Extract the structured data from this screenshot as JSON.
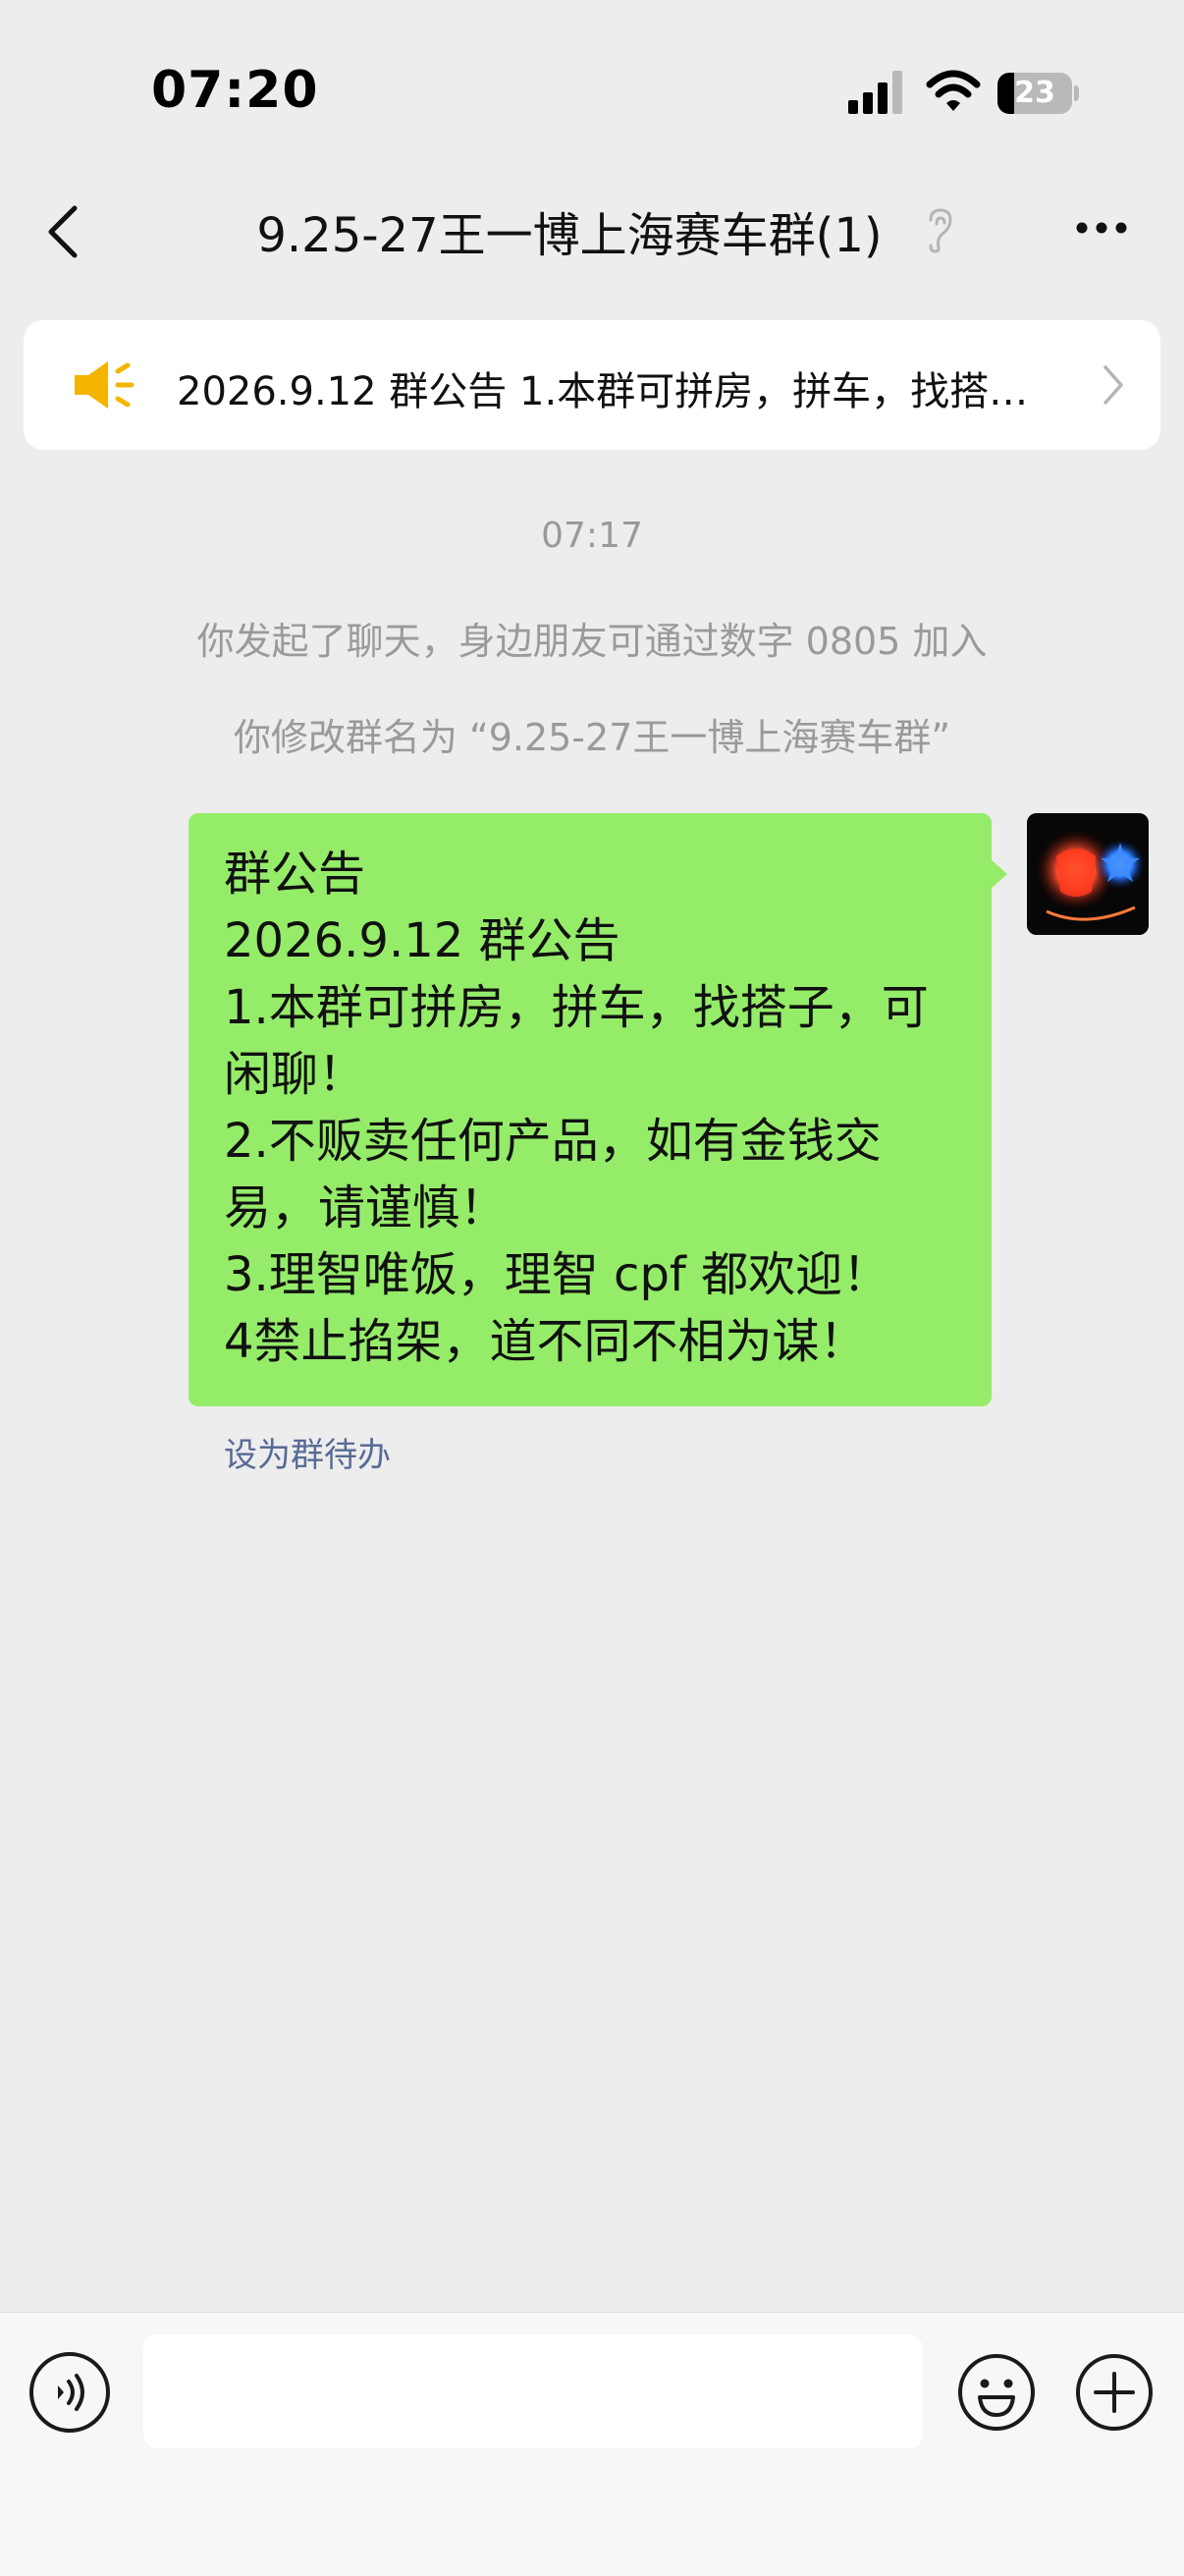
{
  "status_bar": {
    "time": "07:20",
    "battery_level": "23",
    "battery_fraction": 0.23,
    "icons": [
      "signal-icon",
      "wifi-icon",
      "battery-icon"
    ]
  },
  "nav": {
    "title": "9.25-27王一博上海赛车群(1)",
    "icons": [
      "back-icon",
      "mute-icon",
      "more-icon"
    ]
  },
  "announcement": {
    "text": "2026.9.12 群公告 1.本群可拼房，拼车，找搭…",
    "icons": [
      "speaker-icon",
      "chevron-right-icon"
    ]
  },
  "chat": {
    "time": "07:17",
    "system_messages": [
      "你发起了聊天，身边朋友可通过数字 0805 加入",
      "你修改群名为 “9.25-27王一博上海赛车群”"
    ],
    "message": {
      "lines": [
        "群公告",
        "2026.9.12 群公告",
        "1.本群可拼房，拼车，找搭子，可",
        "闲聊！",
        "2.不贩卖任何产品，如有金钱交",
        "易，请谨慎！",
        "3.理智唯饭，理智 cpf 都欢迎！",
        "4禁止掐架，道不同不相为谋！"
      ],
      "bubble_color": "#95ec69"
    },
    "todo_link": "设为群待办"
  },
  "input_bar": {
    "placeholder": "",
    "icons": [
      "voice-icon",
      "emoji-icon",
      "plus-icon"
    ]
  },
  "colors": {
    "background": "#ededed",
    "system_text": "#9a9a9a",
    "link": "#576b95",
    "speaker": "#f5b400"
  }
}
